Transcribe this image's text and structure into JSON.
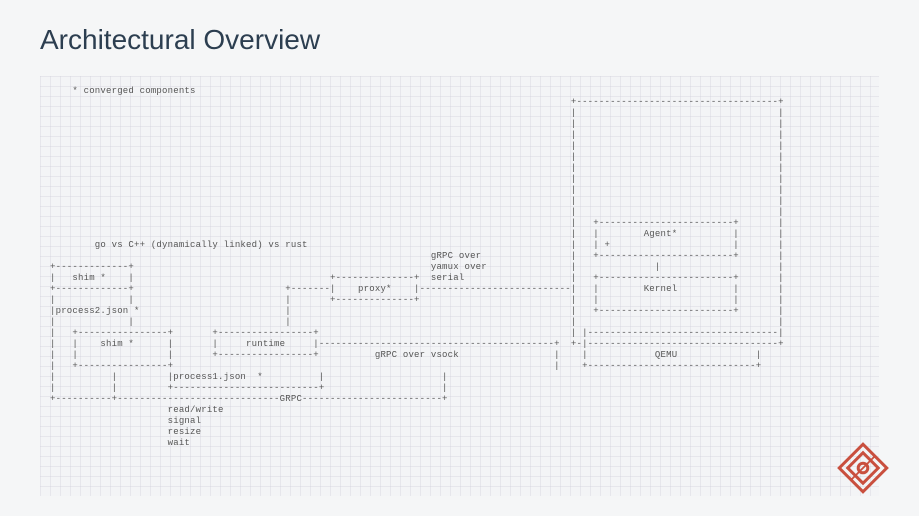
{
  "title": "Architectural Overview",
  "diagram": {
    "legend": "* converged components",
    "note": "go vs C++ (dynamically linked) vs rust",
    "boxes": {
      "shim_top": "shim *",
      "process2": "process2.json *",
      "shim_inner": "shim *",
      "process1": "process1.json  *",
      "runtime": "runtime",
      "proxy": "proxy*",
      "agent": "Agent*",
      "agent_plus": "+",
      "kernel": "Kernel",
      "qemu": "QEMU"
    },
    "connectors": {
      "grpc_yamux": "gRPC over\nyamux over\nserial",
      "grpc_vsock": "gRPC over vsock",
      "grpc_label": "GRPC"
    },
    "ops": [
      "read/write",
      "signal",
      "resize",
      "wait"
    ]
  },
  "ascii_render": "    * converged components\n                                                                                             +------------------------------------+\n                                                                                             |                                    |\n                                                                                             |                                    |\n                                                                                             |                                    |\n                                                                                             |                                    |\n                                                                                             |                                    |\n                                                                                             |                                    |\n                                                                                             |                                    |\n                                                                                             |                                    |\n                                                                                             |                                    |\n                                                                                             |                                    |\n                                                                                             |   +------------------------+       |\n                                                                                             |   |        Agent*          |       |\n        go vs C++ (dynamically linked) vs rust                                               |   | +                      |       |\n                                                                    gRPC over                |   +------------------------+       |\n+-------------+                                                     yamux over               |              |                     |\n|   shim *    |                                   +--------------+  serial                   |   +------------------------+       |\n+-------------+                           +-------|    proxy*    |---------------------------|   |        Kernel          |       |\n|             |                           |       +--------------+                           |   |                        |       |\n|process2.json *                          |                                                  |   +------------------------+       |\n|             |                           |                                                  |                                    |\n|   +----------------+       +-----------------+                                             | |----------------------------------|\n|   |    shim *      |       |     runtime     |------------------------------------------+  +-|----------------------------------+\n|   |                |       +-----------------+          gRPC over vsock                 |    |            QEMU              |\n|   +----------------+                                                                    |    +------------------------------+\n|          |         |process1.json  *          |                     |\n|          |         +--------------------------+                     |\n+----------+-----------------------------GRPC-------------------------+\n                     read/write\n                     signal\n                     resize\n                     wait"
}
